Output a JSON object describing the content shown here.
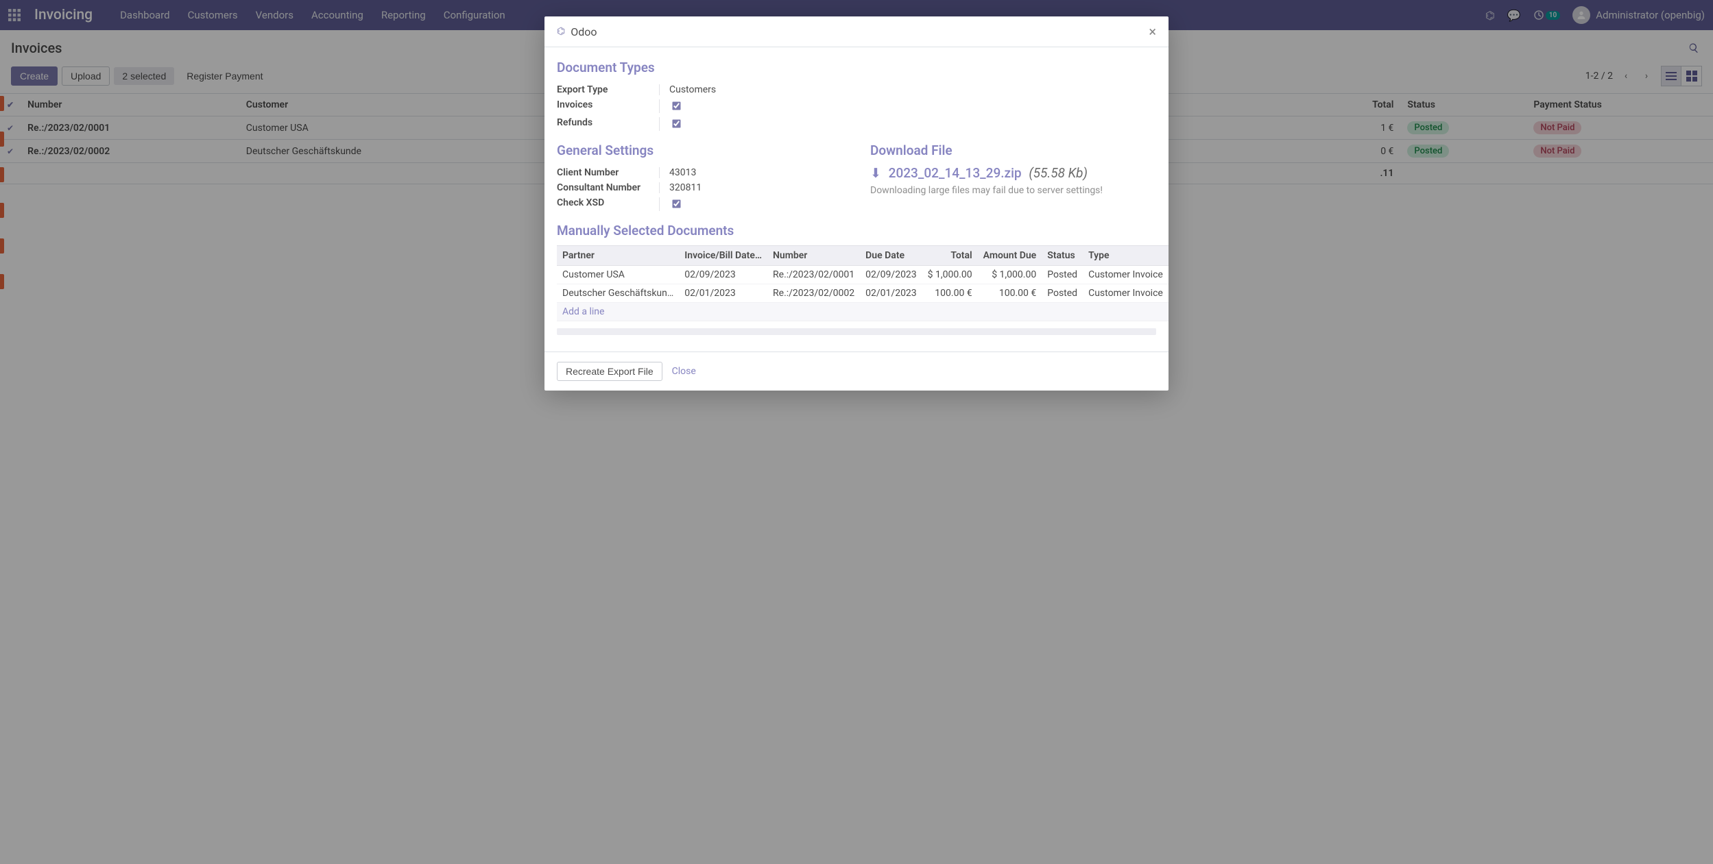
{
  "nav": {
    "brand": "Invoicing",
    "items": [
      "Dashboard",
      "Customers",
      "Vendors",
      "Accounting",
      "Reporting",
      "Configuration"
    ],
    "notification_count": "10",
    "user_name": "Administrator (openbig)"
  },
  "header": {
    "breadcrumb": "Invoices"
  },
  "toolbar": {
    "create": "Create",
    "upload": "Upload",
    "selected": "2 selected",
    "register_payment": "Register Payment",
    "pager": "1-2 / 2"
  },
  "table": {
    "headers": {
      "number": "Number",
      "customer": "Customer",
      "total": "Total",
      "status": "Status",
      "payment_status": "Payment Status"
    },
    "rows": [
      {
        "number": "Re.:/2023/02/0001",
        "customer": "Customer USA",
        "total_visible": "1 €",
        "status": "Posted",
        "payment": "Not Paid"
      },
      {
        "number": "Re.:/2023/02/0002",
        "customer": "Deutscher Geschäftskunde",
        "total_visible": "0 €",
        "status": "Posted",
        "payment": "Not Paid"
      }
    ],
    "totals_visible": ".11"
  },
  "modal": {
    "title": "Odoo",
    "sections": {
      "doc_types": "Document Types",
      "general": "General Settings",
      "download": "Download File",
      "selected": "Manually Selected Documents"
    },
    "doc_types": {
      "export_type_label": "Export Type",
      "export_type_value": "Customers",
      "invoices_label": "Invoices",
      "refunds_label": "Refunds"
    },
    "general": {
      "client_number_label": "Client Number",
      "client_number_value": "43013",
      "consultant_number_label": "Consultant Number",
      "consultant_number_value": "320811",
      "check_xsd_label": "Check XSD"
    },
    "download": {
      "filename": "2023_02_14_13_29.zip",
      "size": "(55.58 Kb)",
      "hint": "Downloading large files may fail due to server settings!"
    },
    "docs": {
      "headers": {
        "partner": "Partner",
        "invoice_date": "Invoice/Bill Date…",
        "number": "Number",
        "due_date": "Due Date",
        "total": "Total",
        "amount_due": "Amount Due",
        "status": "Status",
        "type": "Type"
      },
      "rows": [
        {
          "partner": "Customer USA",
          "date": "02/09/2023",
          "number": "Re.:/2023/02/0001",
          "due": "02/09/2023",
          "total": "$ 1,000.00",
          "amount_due": "$ 1,000.00",
          "status": "Posted",
          "type": "Customer Invoice"
        },
        {
          "partner": "Deutscher Geschäftskun…",
          "date": "02/01/2023",
          "number": "Re.:/2023/02/0002",
          "due": "02/01/2023",
          "total": "100.00 €",
          "amount_due": "100.00 €",
          "status": "Posted",
          "type": "Customer Invoice"
        }
      ],
      "add_line": "Add a line"
    },
    "footer": {
      "recreate": "Recreate Export File",
      "close": "Close"
    }
  }
}
